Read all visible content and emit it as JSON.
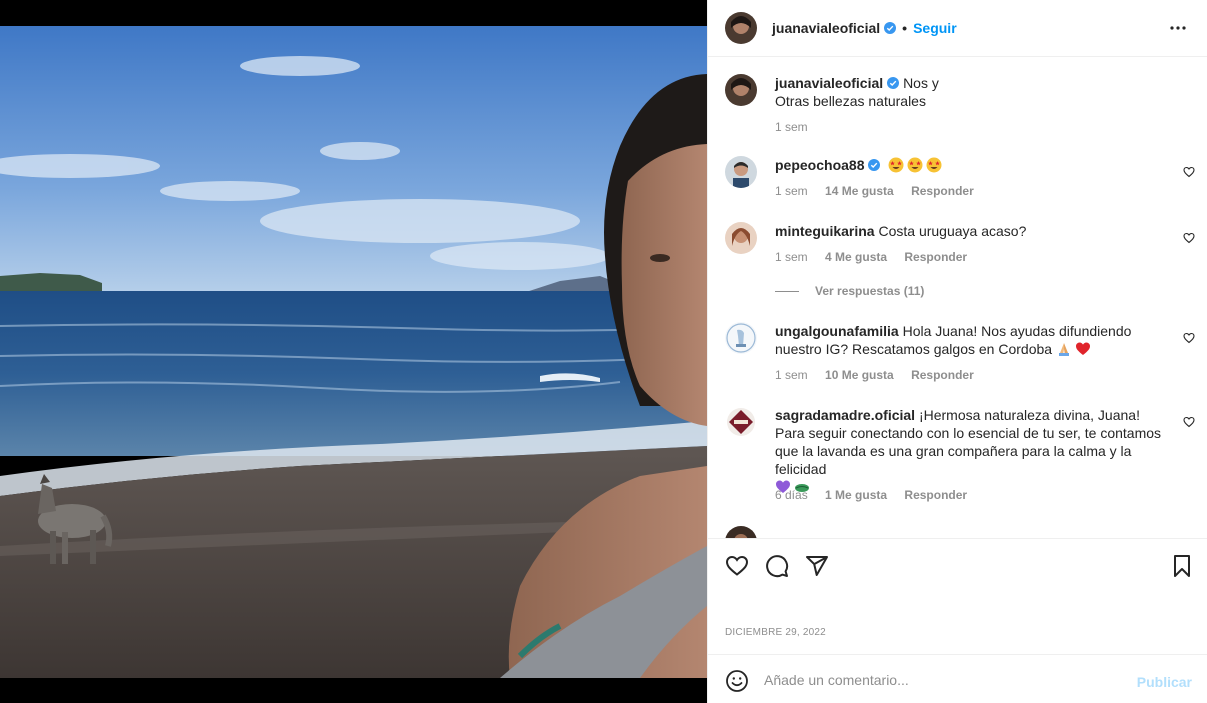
{
  "header": {
    "username": "juanavialeoficial",
    "separator": "•",
    "follow_label": "Seguir",
    "more_icon": "more-horizontal-icon"
  },
  "caption": {
    "username": "juanavialeoficial",
    "text_line1": "Nos y",
    "text_line2": "Otras bellezas naturales",
    "time": "1 sem"
  },
  "comments": [
    {
      "username": "pepeochoa88",
      "text": "",
      "emojis": [
        "star-struck",
        "star-struck",
        "star-struck"
      ],
      "time": "1 sem",
      "likes": "14 Me gusta",
      "reply": "Responder"
    },
    {
      "username": "minteguikarina",
      "text": "Costa uruguaya acaso?",
      "time": "1 sem",
      "likes": "4 Me gusta",
      "reply": "Responder"
    },
    {
      "username": "ungalgounafamilia",
      "text": "Hola Juana! Nos ayudas difundiendo nuestro IG? Rescatamos galgos en Cordoba",
      "emojis": [
        "folded-hands",
        "red-heart"
      ],
      "time": "1 sem",
      "likes": "10 Me gusta",
      "reply": "Responder"
    },
    {
      "username": "sagradamadre.oficial",
      "text": "¡Hermosa naturaleza divina, Juana! Para seguir conectando con lo esencial de tu ser, te contamos que la lavanda es una gran compañera para la calma y la felicidad",
      "emojis": [
        "purple-heart",
        "herb"
      ],
      "time": "6 días",
      "likes": "1 Me gusta",
      "reply": "Responder"
    }
  ],
  "view_replies": "Ver respuestas (11)",
  "actions": {
    "like_icon": "heart-icon",
    "comment_icon": "comment-icon",
    "share_icon": "send-icon",
    "save_icon": "bookmark-icon"
  },
  "date": "DICIEMBRE 29, 2022",
  "add_comment": {
    "placeholder": "Añade un comentario...",
    "publish_label": "Publicar"
  },
  "colors": {
    "link_blue": "#0095f6",
    "publish_disabled": "#b2dffc",
    "muted_text": "#8e8e8e",
    "verified_blue": "#3897f0"
  }
}
